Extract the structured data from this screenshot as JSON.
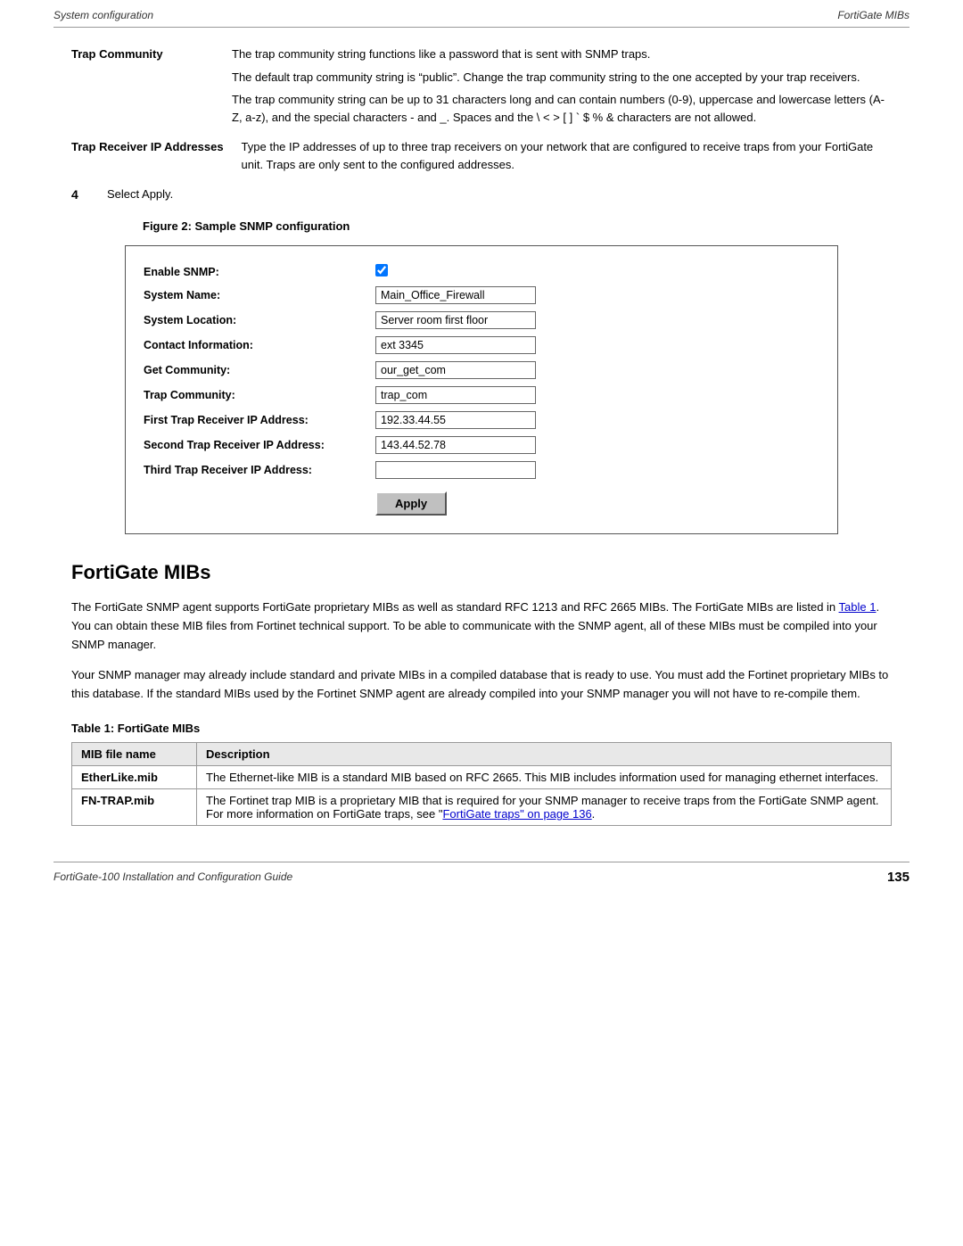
{
  "header": {
    "left": "System configuration",
    "right": "FortiGate MIBs"
  },
  "trap_community": {
    "term": "Trap Community",
    "desc1": "The trap community string functions like a password that is sent with SNMP traps.",
    "desc2": "The default trap community string is “public”. Change the trap community string to the one accepted by your trap receivers.",
    "desc3": "The trap community string can be up to 31 characters long and can contain numbers (0-9), uppercase and lowercase letters (A-Z, a-z), and the special characters - and _. Spaces and the \\ < > [ ] ` $ % & characters are not allowed."
  },
  "trap_receiver": {
    "term": "Trap Receiver IP Addresses",
    "desc": "Type the IP addresses of up to three trap receivers on your network that are configured to receive traps from your FortiGate unit. Traps are only sent to the configured addresses."
  },
  "step4": {
    "number": "4",
    "text": "Select Apply."
  },
  "figure": {
    "caption": "Figure 2:  Sample SNMP configuration"
  },
  "snmp_form": {
    "enable_snmp_label": "Enable SNMP:",
    "system_name_label": "System Name:",
    "system_name_value": "Main_Office_Firewall",
    "system_location_label": "System Location:",
    "system_location_value": "Server room first floor",
    "contact_info_label": "Contact Information:",
    "contact_info_value": "ext 3345",
    "get_community_label": "Get Community:",
    "get_community_value": "our_get_com",
    "trap_community_label": "Trap Community:",
    "trap_community_value": "trap_com",
    "first_trap_label": "First Trap Receiver IP Address:",
    "first_trap_value": "192.33.44.55",
    "second_trap_label": "Second Trap Receiver IP Address:",
    "second_trap_value": "143.44.52.78",
    "third_trap_label": "Third Trap Receiver IP Address:",
    "third_trap_value": "",
    "apply_label": "Apply"
  },
  "fortigate_mibs": {
    "title": "FortiGate MIBs",
    "para1": "The FortiGate SNMP agent supports FortiGate proprietary MIBs as well as standard RFC 1213 and RFC 2665 MIBs. The FortiGate MIBs are listed in Table 1. You can obtain these MIB files from Fortinet technical support. To be able to communicate with the SNMP agent, all of these MIBs must be compiled into your SNMP manager.",
    "para1_link": "Table 1",
    "para2": "Your SNMP manager may already include standard and private MIBs in a compiled database that is ready to use. You must add the Fortinet proprietary MIBs to this database. If the standard MIBs used by the Fortinet SNMP agent are already compiled into your SNMP manager you will not have to re-compile them.",
    "table_caption": "Table 1: FortiGate MIBs",
    "table_headers": [
      "MIB file name",
      "Description"
    ],
    "table_rows": [
      {
        "name": "EtherLike.mib",
        "desc": "The Ethernet-like MIB is a standard MIB based on RFC 2665. This MIB includes information used for managing ethernet interfaces."
      },
      {
        "name": "FN-TRAP.mib",
        "desc": "The Fortinet trap MIB is a proprietary MIB that is required for your SNMP manager to receive traps from the FortiGate SNMP agent. For more information on FortiGate traps, see “FortiGate traps” on page 136.",
        "link_text": "FortiGate traps” on page 136"
      }
    ]
  },
  "footer": {
    "left": "FortiGate-100 Installation and Configuration Guide",
    "right": "135"
  }
}
